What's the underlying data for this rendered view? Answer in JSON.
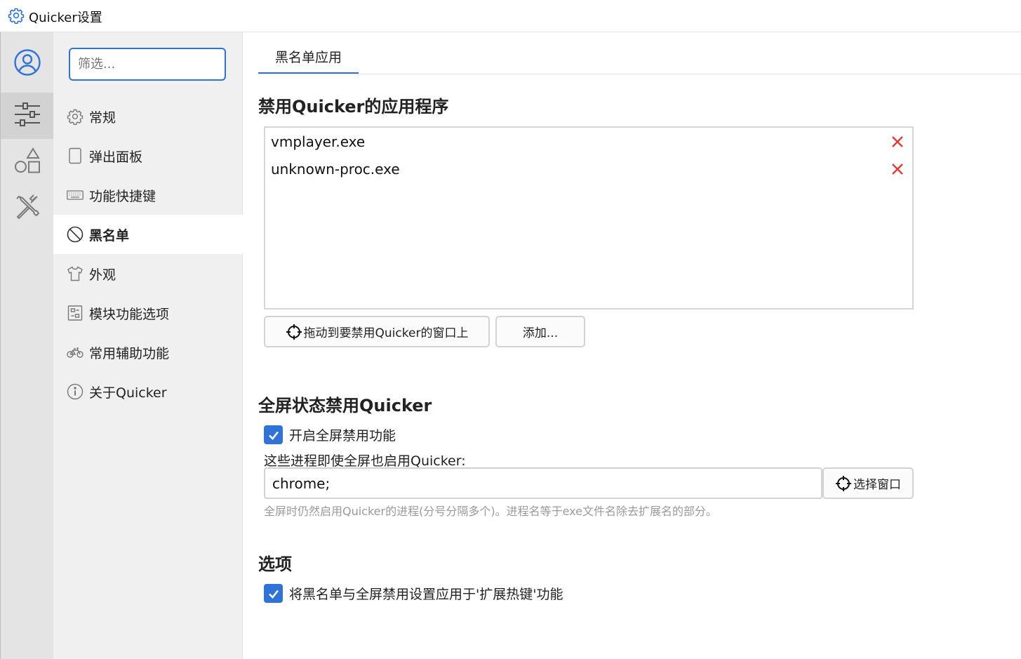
{
  "window": {
    "title": "Quicker设置",
    "app_icon": "gear-icon"
  },
  "rail": {
    "items": [
      {
        "icon": "user-icon",
        "active": false
      },
      {
        "icon": "sliders-icon",
        "active": true
      },
      {
        "icon": "shapes-icon",
        "active": false
      },
      {
        "icon": "tools-icon",
        "active": false
      }
    ]
  },
  "nav": {
    "filter_placeholder": "筛选...",
    "items": [
      {
        "label": "常规",
        "icon": "gear-icon"
      },
      {
        "label": "弹出面板",
        "icon": "panel-icon"
      },
      {
        "label": "功能快捷键",
        "icon": "keyboard-icon"
      },
      {
        "label": "黑名单",
        "icon": "block-icon",
        "active": true
      },
      {
        "label": "外观",
        "icon": "tshirt-icon"
      },
      {
        "label": "模块功能选项",
        "icon": "module-icon"
      },
      {
        "label": "常用辅助功能",
        "icon": "bicycle-icon"
      },
      {
        "label": "关于Quicker",
        "icon": "info-icon"
      }
    ]
  },
  "main": {
    "tab_label": "黑名单应用",
    "blacklist": {
      "heading": "禁用Quicker的应用程序",
      "apps": [
        "vmplayer.exe",
        "unknown-proc.exe"
      ],
      "drag_button_label": "拖动到要禁用Quicker的窗口上",
      "add_button_label": "添加..."
    },
    "fullscreen": {
      "heading": "全屏状态禁用Quicker",
      "enable_label": "开启全屏禁用功能",
      "enable_checked": true,
      "exceptions_label": "这些进程即使全屏也启用Quicker:",
      "exceptions_value": "chrome;",
      "select_window_label": "选择窗口",
      "hint": "全屏时仍然启用Quicker的进程(分号分隔多个)。进程名等于exe文件名除去扩展名的部分。"
    },
    "options": {
      "heading": "选项",
      "apply_label": "将黑名单与全屏禁用设置应用于'扩展热键'功能",
      "apply_checked": true
    }
  },
  "colors": {
    "accent": "#2f73d9",
    "delete": "#e53935"
  }
}
